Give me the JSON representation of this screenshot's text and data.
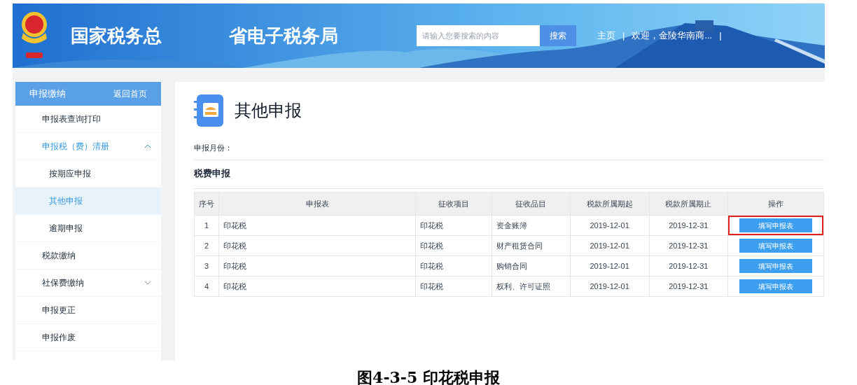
{
  "header": {
    "title_parts": [
      "国家税务总",
      "省电子税务局"
    ],
    "search": {
      "placeholder": "请输入您要搜索的内容",
      "button": "搜索"
    },
    "nav": [
      "主页",
      "|",
      "欢迎，金陵华南商...",
      "|"
    ]
  },
  "sidebar": {
    "title": "申报缴纳",
    "action": "返回首页",
    "items": [
      {
        "label": "申报表查询打印",
        "selected": false
      },
      {
        "label": "申报税（费）清册",
        "selected": false,
        "expanded": true,
        "children": [
          {
            "label": "按期应申报",
            "selected": false
          },
          {
            "label": "其他申报",
            "selected": true
          },
          {
            "label": "逾期申报",
            "selected": false
          }
        ]
      },
      {
        "label": "税款缴纳",
        "selected": false
      },
      {
        "label": "社保费缴纳",
        "selected": false,
        "expanded": false
      },
      {
        "label": "申报更正",
        "selected": false
      },
      {
        "label": "申报作废",
        "selected": false
      }
    ]
  },
  "main": {
    "title": "其他申报",
    "month_label": "申报月份：",
    "section": "税费申报",
    "table": {
      "columns": [
        "序号",
        "申报表",
        "征收项目",
        "征收品目",
        "税款所属期起",
        "税款所属期止",
        "操作"
      ],
      "rows": [
        {
          "cells": [
            "1",
            "印花税",
            "印花税",
            "资金账簿",
            "2019-12-01",
            "2019-12-31"
          ],
          "action": "填写申报表",
          "highlighted": true
        },
        {
          "cells": [
            "2",
            "印花税",
            "印花税",
            "财产租赁合同",
            "2019-12-01",
            "2019-12-31"
          ],
          "action": "填写申报表",
          "highlighted": false
        },
        {
          "cells": [
            "3",
            "印花税",
            "印花税",
            "购销合同",
            "2019-12-01",
            "2019-12-31"
          ],
          "action": "填写申报表",
          "highlighted": false
        },
        {
          "cells": [
            "4",
            "印花税",
            "印花税",
            "权利、许可证照",
            "2019-12-01",
            "2019-12-31"
          ],
          "action": "填写申报表",
          "highlighted": false
        }
      ]
    }
  },
  "caption": "图4-3-5 印花税申报"
}
